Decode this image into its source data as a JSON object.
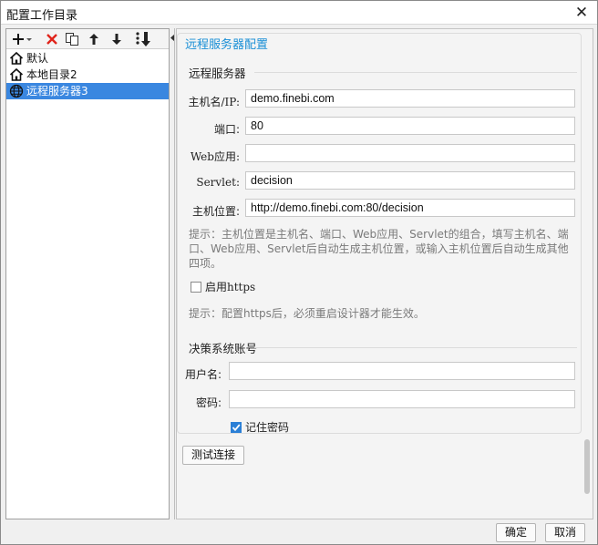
{
  "window": {
    "title": "配置工作目录",
    "close_glyph": "✕"
  },
  "tree": {
    "items": [
      {
        "label": "默认",
        "icon": "home-icon",
        "selected": false
      },
      {
        "label": "本地目录2",
        "icon": "home-icon",
        "selected": false
      },
      {
        "label": "远程服务器3",
        "icon": "globe-icon",
        "selected": true
      }
    ]
  },
  "panel": {
    "section_title": "远程服务器配置",
    "server_heading": "远程服务器",
    "fields": {
      "host": {
        "label": "主机名/IP:",
        "value": "demo.finebi.com"
      },
      "port": {
        "label": "端口:",
        "value": "80"
      },
      "webapp": {
        "label": "Web应用:",
        "value": ""
      },
      "servlet": {
        "label": "Servlet:",
        "value": "decision"
      },
      "location": {
        "label": "主机位置:",
        "value": "http://demo.finebi.com:80/decision"
      }
    },
    "hint_location": "提示：主机位置是主机名、端口、Web应用、Servlet的组合，填写主机名、端口、Web应用、Servlet后自动生成主机位置，或输入主机位置后自动生成其他四项。",
    "https_label": "启用https",
    "https_checked": false,
    "hint_https": "提示：配置https后，必须重启设计器才能生效。",
    "account_heading": "决策系统账号",
    "username": {
      "label": "用户名:",
      "value": ""
    },
    "password": {
      "label": "密码:",
      "value": ""
    },
    "remember_label": "记住密码",
    "remember_checked": true,
    "test_button": "测试连接"
  },
  "footer": {
    "ok": "确定",
    "cancel": "取消"
  },
  "colors": {
    "accent": "#1a8fd6",
    "selection": "#3a87e0",
    "delete_red": "#e0241b"
  }
}
